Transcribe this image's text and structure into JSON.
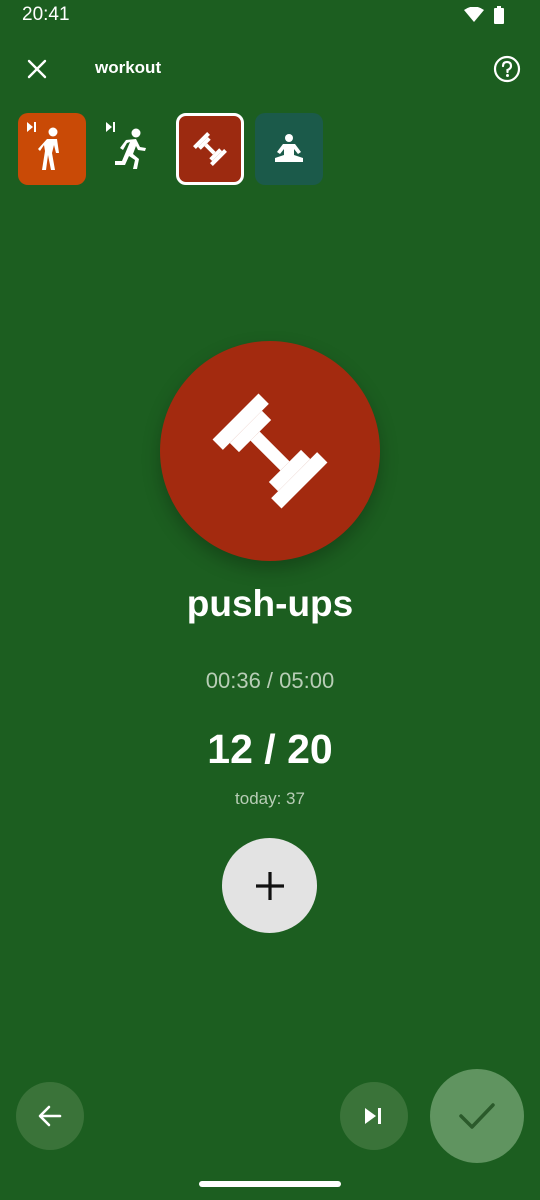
{
  "status_bar": {
    "time": "20:41",
    "icons": [
      "wifi-icon",
      "battery-icon"
    ]
  },
  "app_bar": {
    "title": "workout",
    "close_icon": "close-icon",
    "help_icon": "help-icon"
  },
  "activities": [
    {
      "name": "walk",
      "icon": "walking-icon",
      "skip_marker": true,
      "color": "#c94a06",
      "selected": false
    },
    {
      "name": "run",
      "icon": "running-icon",
      "skip_marker": true,
      "color": "transparent",
      "selected": false
    },
    {
      "name": "strength",
      "icon": "dumbbell-icon",
      "skip_marker": false,
      "color": "#9c2a10",
      "selected": true
    },
    {
      "name": "meditation",
      "icon": "meditation-icon",
      "skip_marker": false,
      "color": "#1b5a4a",
      "selected": false
    }
  ],
  "exercise": {
    "icon": "dumbbell-icon",
    "name": "push-ups",
    "timer": "00:36 / 05:00",
    "reps": "12 / 20",
    "today": "today: 37"
  },
  "controls": {
    "add_icon": "plus-icon",
    "back_icon": "arrow-left-icon",
    "skip_icon": "skip-next-icon",
    "done_icon": "check-icon"
  },
  "colors": {
    "background": "#1c5e20",
    "accent_red": "#a32a0f",
    "walk_orange": "#c94a06",
    "yoga_teal": "#1b5a4a"
  }
}
